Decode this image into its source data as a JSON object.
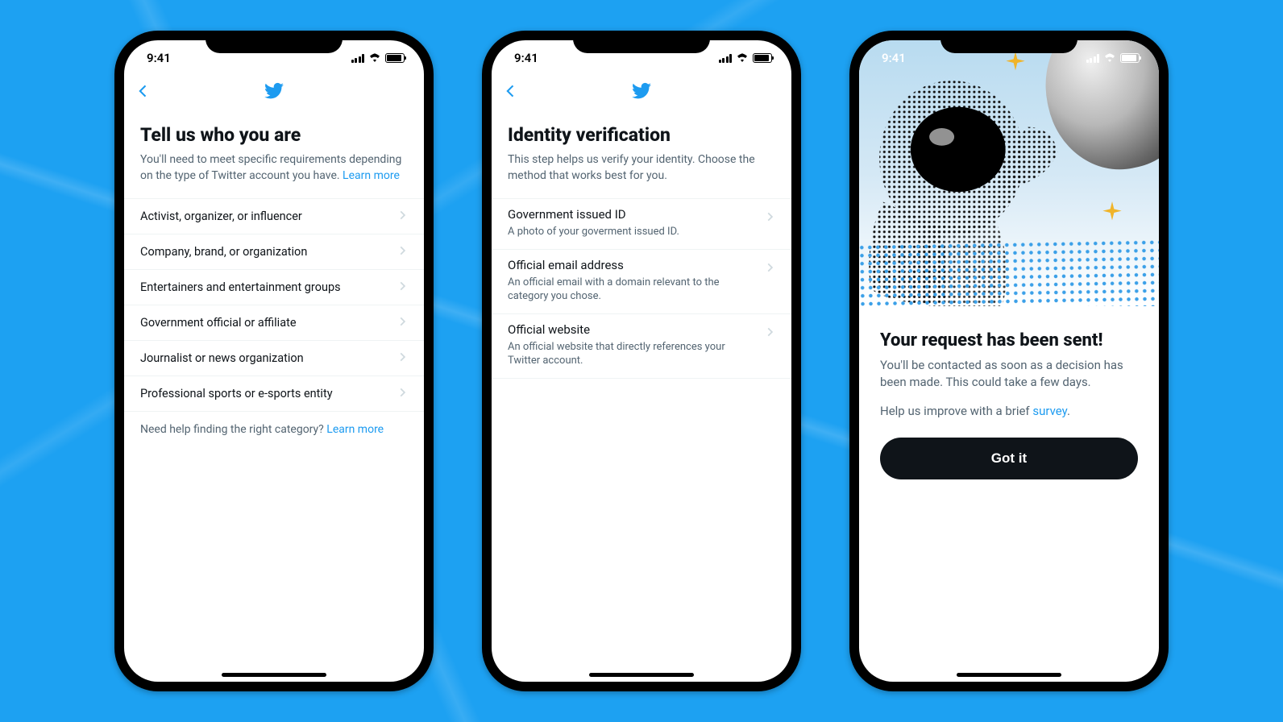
{
  "status": {
    "time": "9:41"
  },
  "screen1": {
    "title": "Tell us who you are",
    "subtitle_text": "You'll need to meet specific requirements depending on the type of Twitter account you have. ",
    "subtitle_link": "Learn more",
    "categories": [
      "Activist, organizer, or influencer",
      "Company, brand, or organization",
      "Entertainers and entertainment groups",
      "Government official or affiliate",
      "Journalist or news organization",
      "Professional sports or e-sports entity"
    ],
    "help_text": "Need help finding the right category? ",
    "help_link": "Learn more"
  },
  "screen2": {
    "title": "Identity verification",
    "subtitle": "This step helps us verify your identity. Choose the method that works best for you.",
    "methods": [
      {
        "title": "Government issued ID",
        "desc": "A photo of your goverment issued ID."
      },
      {
        "title": "Official email address",
        "desc": "An official email with a domain relevant to the category you chose."
      },
      {
        "title": "Official website",
        "desc": "An official website that directly references your Twitter account."
      }
    ]
  },
  "screen3": {
    "title": "Your request has been sent!",
    "subtitle": "You'll be contacted as soon as a decision has been made. This could take a few days.",
    "survey_text": "Help us improve with a brief ",
    "survey_link": "survey",
    "survey_period": ".",
    "button": "Got it"
  }
}
